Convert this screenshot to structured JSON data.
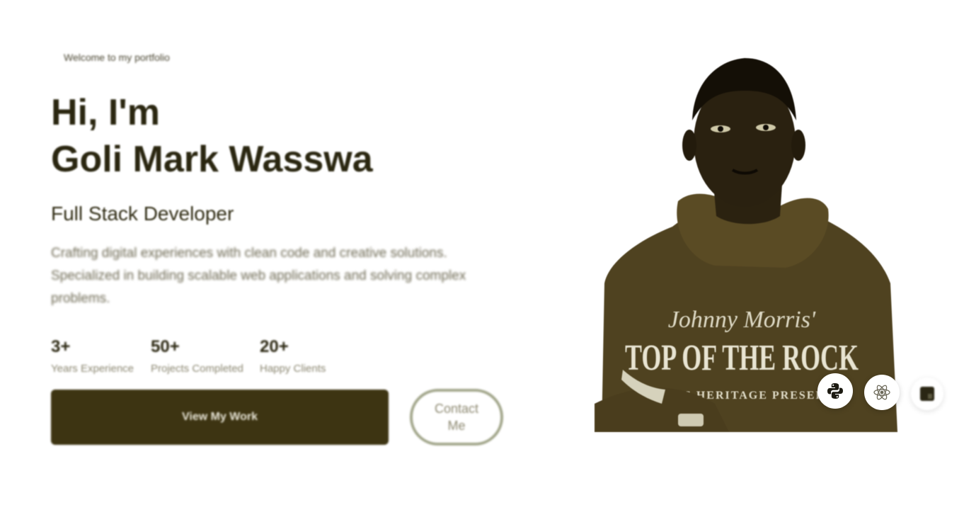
{
  "hero": {
    "welcome": "Welcome to my portfolio",
    "greeting": "Hi, I'm",
    "name": "Goli Mark Wasswa",
    "role": "Full Stack Developer",
    "description": "Crafting digital experiences with clean code and creative solutions. Specialized in building scalable web applications and solving complex problems."
  },
  "stats": [
    {
      "value": "3+",
      "label": "Years Experience"
    },
    {
      "value": "50+",
      "label": "Projects Completed"
    },
    {
      "value": "20+",
      "label": "Happy Clients"
    }
  ],
  "actions": {
    "primary_label": "View My Work",
    "secondary_label": "Contact Me"
  },
  "photo": {
    "shirt_script": "Johnny Morris'",
    "shirt_line1": "TOP OF THE ROCK",
    "shirt_line2": "OZARKS HERITAGE PRESERVE"
  },
  "tech_icons": [
    "python-icon",
    "react-icon",
    "javascript-icon"
  ],
  "colors": {
    "accent": "#3d3412",
    "text": "#2e2a12",
    "muted": "#8a8670",
    "outline": "#a3a78c"
  }
}
